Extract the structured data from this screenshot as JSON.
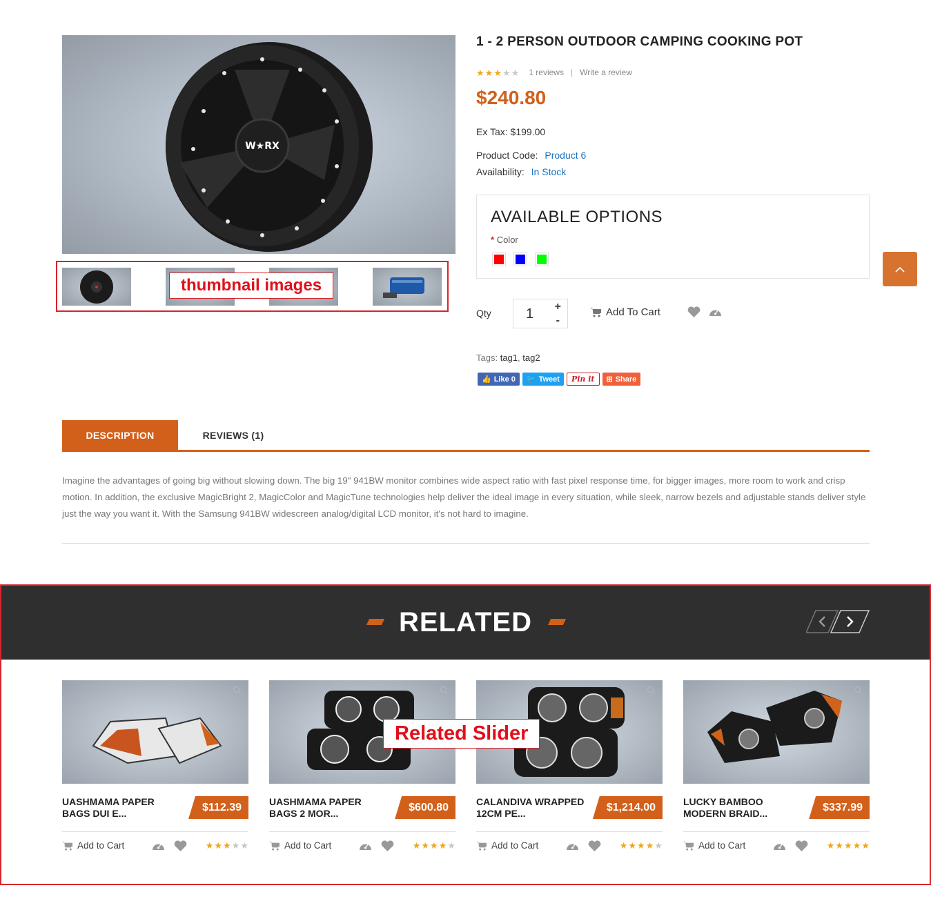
{
  "product": {
    "title": "1 - 2 PERSON OUTDOOR CAMPING COOKING POT",
    "rating": 3,
    "reviews_text": "1 reviews",
    "write_review": "Write a review",
    "price": "$240.80",
    "ex_tax": "Ex Tax: $199.00",
    "code_label": "Product Code:",
    "code_value": "Product 6",
    "availability_label": "Availability:",
    "availability_value": "In Stock",
    "image_logo": "W★RX"
  },
  "annotations": {
    "thumbnails": "thumbnail images",
    "related": "Related Slider"
  },
  "options": {
    "heading": "AVAILABLE OPTIONS",
    "required_mark": "*",
    "color_label": "Color",
    "colors": [
      "#ff0000",
      "#0000ff",
      "#00ff00"
    ]
  },
  "cart": {
    "qty_label": "Qty",
    "qty_value": "1",
    "plus": "+",
    "minus": "-",
    "add_label": "Add To Cart"
  },
  "tags": {
    "label": "Tags:",
    "items": [
      "tag1",
      "tag2"
    ],
    "separator": ","
  },
  "social": {
    "fb": "Like 0",
    "tw": "Tweet",
    "pin": "Pin it",
    "share": "Share"
  },
  "tabs": {
    "description": "DESCRIPTION",
    "reviews": "REVIEWS (1)"
  },
  "description": "Imagine the advantages of going big without slowing down. The big 19\" 941BW monitor combines wide aspect ratio with fast pixel response time, for bigger images, more room to work and crisp motion. In addition, the exclusive MagicBright 2, MagicColor and MagicTune technologies help deliver the ideal image in every situation, while sleek, narrow bezels and adjustable stands deliver style just the way you want it. With the Samsung 941BW widescreen analog/digital LCD monitor, it's not hard to imagine.",
  "related": {
    "title": "RELATED",
    "cart_label": "Add to Cart",
    "items": [
      {
        "name1": "UASHMAMA PAPER",
        "name2": "BAGS DUI E...",
        "price": "$112.39",
        "rating": 3
      },
      {
        "name1": "UASHMAMA PAPER",
        "name2": "BAGS 2 MOR...",
        "price": "$600.80",
        "rating": 4
      },
      {
        "name1": "CALANDIVA WRAPPED",
        "name2": "12CM PE...",
        "price": "$1,214.00",
        "rating": 4
      },
      {
        "name1": "LUCKY BAMBOO",
        "name2": "MODERN BRAID...",
        "price": "$337.99",
        "rating": 5
      }
    ]
  },
  "colors": {
    "accent": "#d2601a",
    "link": "#1a73c2",
    "dark_band": "#2f2f2f",
    "annotation": "#d8232a"
  }
}
